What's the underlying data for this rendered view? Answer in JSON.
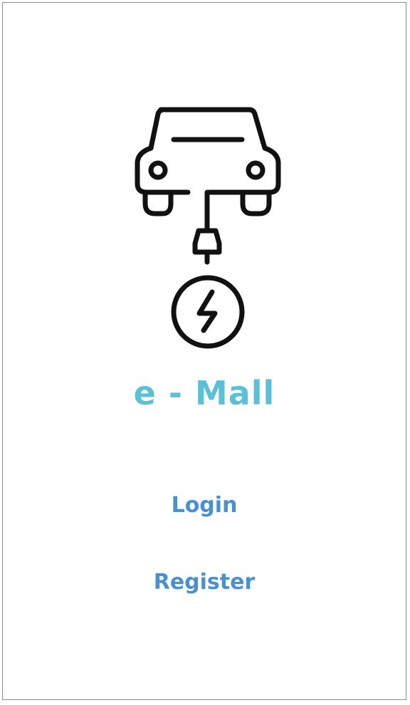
{
  "app": {
    "title": "e - Mall",
    "logo_icon": "ev-car-charging-icon"
  },
  "actions": {
    "login_label": "Login",
    "register_label": "Register"
  },
  "colors": {
    "title": "#5bbfd5",
    "link": "#4a90d0",
    "icon": "#111111",
    "background": "#ffffff"
  }
}
